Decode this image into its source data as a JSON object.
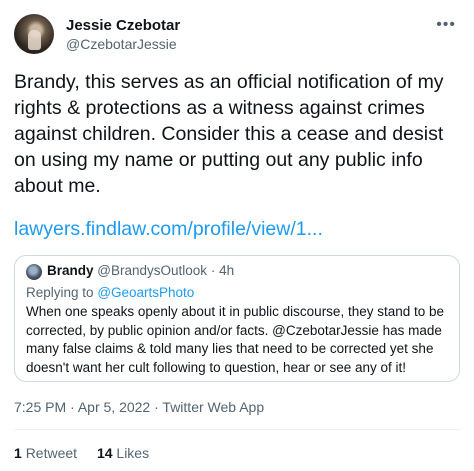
{
  "tweet": {
    "author": {
      "display_name": "Jessie Czebotar",
      "handle": "@CzebotarJessie"
    },
    "more_icon": "more-horizontal-icon",
    "text": "Brandy, this serves as an official notification of my rights & protections as a witness against crimes against children. Consider this a cease and desist on using my name or putting out any public info about me.",
    "link_text": "lawyers.findlaw.com/profile/view/1...",
    "quote": {
      "display_name": "Brandy",
      "handle": "@BrandysOutlook",
      "separator": "·",
      "time": "4h",
      "replying_prefix": "Replying to",
      "replying_handle": "@GeoartsPhoto",
      "text": "When one speaks openly about it in public discourse, they stand to be corrected, by public opinion and/or facts. @CzebotarJessie has made many false claims & told many lies that need to be corrected yet she doesn't want her cult following to question, hear or see any of it!"
    },
    "meta": {
      "time": "7:25 PM",
      "separator": "·",
      "date": "Apr 5, 2022",
      "source": "Twitter Web App"
    },
    "stats": {
      "retweets_count": "1",
      "retweets_label": "Retweet",
      "likes_count": "14",
      "likes_label": "Likes"
    }
  },
  "colors": {
    "text_primary": "#0f1419",
    "text_secondary": "#536471",
    "link": "#1d9bf0",
    "border": "#cfd9de"
  }
}
